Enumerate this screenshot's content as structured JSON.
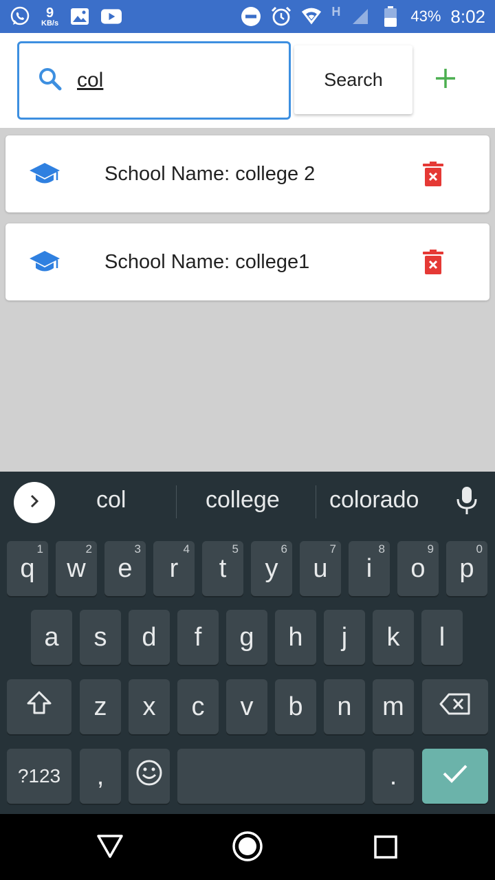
{
  "statusbar": {
    "net_speed_value": "9",
    "net_speed_unit": "KB/s",
    "network_type": "H",
    "battery": "43%",
    "time": "8:02"
  },
  "search": {
    "value": "col",
    "button_label": "Search"
  },
  "schools": [
    {
      "label": "School Name: college 2"
    },
    {
      "label": "School Name: college1"
    }
  ],
  "keyboard": {
    "suggestions": [
      "col",
      "college",
      "colorado"
    ],
    "row1": [
      {
        "key": "q",
        "hint": "1"
      },
      {
        "key": "w",
        "hint": "2"
      },
      {
        "key": "e",
        "hint": "3"
      },
      {
        "key": "r",
        "hint": "4"
      },
      {
        "key": "t",
        "hint": "5"
      },
      {
        "key": "y",
        "hint": "6"
      },
      {
        "key": "u",
        "hint": "7"
      },
      {
        "key": "i",
        "hint": "8"
      },
      {
        "key": "o",
        "hint": "9"
      },
      {
        "key": "p",
        "hint": "0"
      }
    ],
    "row2": [
      "a",
      "s",
      "d",
      "f",
      "g",
      "h",
      "j",
      "k",
      "l"
    ],
    "row3": [
      "z",
      "x",
      "c",
      "v",
      "b",
      "n",
      "m"
    ],
    "symbols_label": "?123",
    "comma": ",",
    "period": "."
  },
  "colors": {
    "statusbar": "#3b6fc9",
    "accent_blue": "#3d8fe0",
    "add_green": "#4caf50",
    "delete_red": "#e53935",
    "enter_key": "#6bb3aa"
  }
}
